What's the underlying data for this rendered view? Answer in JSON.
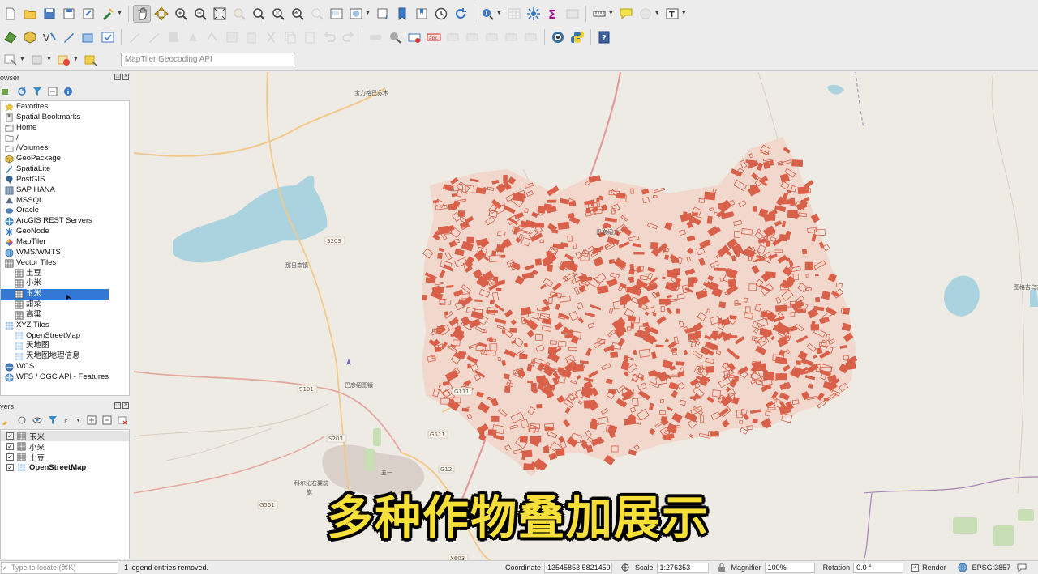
{
  "toolbar": {
    "row1_icons": [
      "new-project-icon",
      "open-project-icon",
      "save-project-icon",
      "save-as-icon",
      "print-layout-icon",
      "style-manager-icon",
      "pan-icon",
      "pan-to-selection-icon",
      "zoom-in-icon",
      "zoom-out-icon",
      "zoom-full-icon",
      "zoom-to-selection-icon",
      "zoom-to-layer-icon",
      "zoom-native-icon",
      "zoom-last-icon",
      "zoom-next-icon",
      "new-map-view-icon",
      "new-3d-view-icon",
      "temporal-icon",
      "bookmark-icon",
      "show-bookmarks-icon",
      "refresh-icon",
      "identify-icon",
      "attribute-table-icon",
      "processing-icon",
      "statistics-icon",
      "measure-icon",
      "map-tips-icon",
      "select-icon",
      "text-annotation-icon"
    ],
    "geocoder_placeholder": "MapTiler Geocoding API"
  },
  "browser": {
    "title": "owser",
    "items": [
      {
        "label": "Favorites",
        "icon": "star-icon",
        "level": 0
      },
      {
        "label": "Spatial Bookmarks",
        "icon": "bookmark-icon",
        "level": 0
      },
      {
        "label": "Home",
        "icon": "home-folder-icon",
        "level": 0
      },
      {
        "label": "/",
        "icon": "folder-icon",
        "level": 0
      },
      {
        "label": "/Volumes",
        "icon": "folder-icon",
        "level": 0
      },
      {
        "label": "GeoPackage",
        "icon": "geopackage-icon",
        "level": 0
      },
      {
        "label": "SpatiaLite",
        "icon": "spatialite-icon",
        "level": 0
      },
      {
        "label": "PostGIS",
        "icon": "postgis-icon",
        "level": 0
      },
      {
        "label": "SAP HANA",
        "icon": "sap-hana-icon",
        "level": 0
      },
      {
        "label": "MSSQL",
        "icon": "mssql-icon",
        "level": 0
      },
      {
        "label": "Oracle",
        "icon": "oracle-icon",
        "level": 0
      },
      {
        "label": "ArcGIS REST Servers",
        "icon": "arcgis-icon",
        "level": 0
      },
      {
        "label": "GeoNode",
        "icon": "geonode-icon",
        "level": 0
      },
      {
        "label": "MapTiler",
        "icon": "maptiler-icon",
        "level": 0
      },
      {
        "label": "WMS/WMTS",
        "icon": "wms-icon",
        "level": 0
      },
      {
        "label": "Vector Tiles",
        "icon": "vector-tiles-icon",
        "level": 0
      },
      {
        "label": "土豆",
        "icon": "vector-tile-layer-icon",
        "level": 1
      },
      {
        "label": "小米",
        "icon": "vector-tile-layer-icon",
        "level": 1
      },
      {
        "label": "玉米",
        "icon": "vector-tile-layer-icon",
        "level": 1,
        "selected": true
      },
      {
        "label": "甜菜",
        "icon": "vector-tile-layer-icon",
        "level": 1
      },
      {
        "label": "高粱",
        "icon": "vector-tile-layer-icon",
        "level": 1
      },
      {
        "label": "XYZ Tiles",
        "icon": "xyz-tiles-icon",
        "level": 0
      },
      {
        "label": "OpenStreetMap",
        "icon": "xyz-layer-icon",
        "level": 1
      },
      {
        "label": "天地图",
        "icon": "xyz-layer-icon",
        "level": 1
      },
      {
        "label": "天地图地理信息",
        "icon": "xyz-layer-icon",
        "level": 1
      },
      {
        "label": "WCS",
        "icon": "wcs-icon",
        "level": 0
      },
      {
        "label": "WFS / OGC API - Features",
        "icon": "wfs-icon",
        "level": 0
      }
    ]
  },
  "layers": {
    "title": "yers",
    "items": [
      {
        "label": "玉米",
        "checked": true,
        "icon": "vector-tile-layer-icon",
        "bold": false
      },
      {
        "label": "小米",
        "checked": true,
        "icon": "vector-tile-layer-icon",
        "bold": false
      },
      {
        "label": "土豆",
        "checked": true,
        "icon": "vector-tile-layer-icon",
        "bold": false
      },
      {
        "label": "OpenStreetMap",
        "checked": true,
        "icon": "xyz-layer-icon",
        "bold": true
      }
    ]
  },
  "map": {
    "caption": "多种作物叠加展示",
    "crop_color": "#d9614a",
    "water_color": "#aad3df",
    "background_color": "#eeebe4",
    "labels": [
      {
        "text": "宝力格巴苏木"
      },
      {
        "text": "S203"
      },
      {
        "text": "那日森镇"
      },
      {
        "text": "S101"
      },
      {
        "text": "G111"
      },
      {
        "text": "G511"
      },
      {
        "text": "G12"
      },
      {
        "text": "S203"
      },
      {
        "text": "巴彦绍力"
      },
      {
        "text": "图格吉乌苏"
      },
      {
        "text": "乌兰浩特"
      },
      {
        "text": "G551"
      },
      {
        "text": "巴彦绍图镇"
      },
      {
        "text": "五一"
      },
      {
        "text": "科尔沁右翼前"
      },
      {
        "text": "旗"
      },
      {
        "text": "X603"
      }
    ]
  },
  "status": {
    "locate_placeholder": "Type to locate (⌘K)",
    "message": "1 legend entries removed.",
    "coordinate_label": "Coordinate",
    "coordinate_value": "13545853,5821459",
    "scale_label": "Scale",
    "scale_value": "1:276353",
    "magnifier_label": "Magnifier",
    "magnifier_value": "100%",
    "rotation_label": "Rotation",
    "rotation_value": "0.0 °",
    "render_label": "Render",
    "crs": "EPSG:3857"
  }
}
